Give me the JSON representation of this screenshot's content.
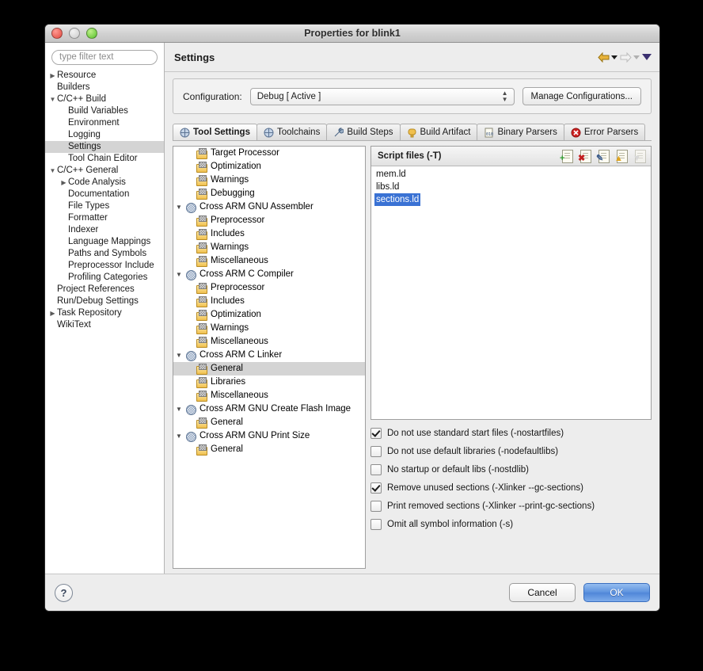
{
  "window": {
    "title": "Properties for blink1",
    "traffic_lights": [
      "close",
      "minimize",
      "zoom"
    ]
  },
  "sidebar": {
    "filter_placeholder": "type filter text",
    "items": [
      {
        "label": "Resource",
        "indent": 0,
        "twisty": "collapsed",
        "selected": false
      },
      {
        "label": "Builders",
        "indent": 0,
        "twisty": "none",
        "selected": false
      },
      {
        "label": "C/C++ Build",
        "indent": 0,
        "twisty": "expanded",
        "selected": false
      },
      {
        "label": "Build Variables",
        "indent": 1,
        "twisty": "none",
        "selected": false
      },
      {
        "label": "Environment",
        "indent": 1,
        "twisty": "none",
        "selected": false
      },
      {
        "label": "Logging",
        "indent": 1,
        "twisty": "none",
        "selected": false
      },
      {
        "label": "Settings",
        "indent": 1,
        "twisty": "none",
        "selected": true
      },
      {
        "label": "Tool Chain Editor",
        "indent": 1,
        "twisty": "none",
        "selected": false
      },
      {
        "label": "C/C++ General",
        "indent": 0,
        "twisty": "expanded",
        "selected": false
      },
      {
        "label": "Code Analysis",
        "indent": 1,
        "twisty": "collapsed",
        "selected": false
      },
      {
        "label": "Documentation",
        "indent": 1,
        "twisty": "none",
        "selected": false
      },
      {
        "label": "File Types",
        "indent": 1,
        "twisty": "none",
        "selected": false
      },
      {
        "label": "Formatter",
        "indent": 1,
        "twisty": "none",
        "selected": false
      },
      {
        "label": "Indexer",
        "indent": 1,
        "twisty": "none",
        "selected": false
      },
      {
        "label": "Language Mappings",
        "indent": 1,
        "twisty": "none",
        "selected": false
      },
      {
        "label": "Paths and Symbols",
        "indent": 1,
        "twisty": "none",
        "selected": false
      },
      {
        "label": "Preprocessor Include",
        "indent": 1,
        "twisty": "none",
        "selected": false
      },
      {
        "label": "Profiling Categories",
        "indent": 1,
        "twisty": "none",
        "selected": false
      },
      {
        "label": "Project References",
        "indent": 0,
        "twisty": "none",
        "selected": false
      },
      {
        "label": "Run/Debug Settings",
        "indent": 0,
        "twisty": "none",
        "selected": false
      },
      {
        "label": "Task Repository",
        "indent": 0,
        "twisty": "collapsed",
        "selected": false
      },
      {
        "label": "WikiText",
        "indent": 0,
        "twisty": "none",
        "selected": false
      }
    ]
  },
  "page": {
    "title": "Settings",
    "nav": {
      "back_icon": "back-arrow-icon",
      "back_menu_icon": "chevron-down-icon",
      "forward_icon": "forward-arrow-icon",
      "forward_menu_icon": "chevron-down-icon",
      "view_menu_icon": "chevron-down-icon"
    }
  },
  "configuration": {
    "label": "Configuration:",
    "value": "Debug  [ Active ]",
    "manage_button": "Manage Configurations..."
  },
  "tabs": [
    {
      "label": "Tool Settings",
      "icon": "tool-icon",
      "active": true
    },
    {
      "label": "Toolchains",
      "icon": "tool-icon",
      "active": false
    },
    {
      "label": "Build Steps",
      "icon": "wrench-icon",
      "active": false
    },
    {
      "label": "Build Artifact",
      "icon": "artifact-icon",
      "active": false
    },
    {
      "label": "Binary Parsers",
      "icon": "binary-icon",
      "active": false
    },
    {
      "label": "Error Parsers",
      "icon": "error-icon",
      "active": false
    }
  ],
  "tool_tree": [
    {
      "label": "Target Processor",
      "indent": 1,
      "twisty": "none",
      "icon": "folder",
      "selected": false
    },
    {
      "label": "Optimization",
      "indent": 1,
      "twisty": "none",
      "icon": "folder",
      "selected": false
    },
    {
      "label": "Warnings",
      "indent": 1,
      "twisty": "none",
      "icon": "folder",
      "selected": false
    },
    {
      "label": "Debugging",
      "indent": 1,
      "twisty": "none",
      "icon": "folder",
      "selected": false
    },
    {
      "label": "Cross ARM GNU Assembler",
      "indent": 0,
      "twisty": "expanded",
      "icon": "tool",
      "selected": false
    },
    {
      "label": "Preprocessor",
      "indent": 1,
      "twisty": "none",
      "icon": "folder",
      "selected": false
    },
    {
      "label": "Includes",
      "indent": 1,
      "twisty": "none",
      "icon": "folder",
      "selected": false
    },
    {
      "label": "Warnings",
      "indent": 1,
      "twisty": "none",
      "icon": "folder",
      "selected": false
    },
    {
      "label": "Miscellaneous",
      "indent": 1,
      "twisty": "none",
      "icon": "folder",
      "selected": false
    },
    {
      "label": "Cross ARM C Compiler",
      "indent": 0,
      "twisty": "expanded",
      "icon": "tool",
      "selected": false
    },
    {
      "label": "Preprocessor",
      "indent": 1,
      "twisty": "none",
      "icon": "folder",
      "selected": false
    },
    {
      "label": "Includes",
      "indent": 1,
      "twisty": "none",
      "icon": "folder",
      "selected": false
    },
    {
      "label": "Optimization",
      "indent": 1,
      "twisty": "none",
      "icon": "folder",
      "selected": false
    },
    {
      "label": "Warnings",
      "indent": 1,
      "twisty": "none",
      "icon": "folder",
      "selected": false
    },
    {
      "label": "Miscellaneous",
      "indent": 1,
      "twisty": "none",
      "icon": "folder",
      "selected": false
    },
    {
      "label": "Cross ARM C Linker",
      "indent": 0,
      "twisty": "expanded",
      "icon": "tool",
      "selected": false
    },
    {
      "label": "General",
      "indent": 1,
      "twisty": "none",
      "icon": "folder",
      "selected": true
    },
    {
      "label": "Libraries",
      "indent": 1,
      "twisty": "none",
      "icon": "folder",
      "selected": false
    },
    {
      "label": "Miscellaneous",
      "indent": 1,
      "twisty": "none",
      "icon": "folder",
      "selected": false
    },
    {
      "label": "Cross ARM GNU Create Flash Image",
      "indent": 0,
      "twisty": "expanded",
      "icon": "tool",
      "selected": false
    },
    {
      "label": "General",
      "indent": 1,
      "twisty": "none",
      "icon": "folder",
      "selected": false
    },
    {
      "label": "Cross ARM GNU Print Size",
      "indent": 0,
      "twisty": "expanded",
      "icon": "tool",
      "selected": false
    },
    {
      "label": "General",
      "indent": 1,
      "twisty": "none",
      "icon": "folder",
      "selected": false
    }
  ],
  "script_files": {
    "title": "Script files (-T)",
    "toolbar": [
      {
        "name": "add-file-icon",
        "glyph": "+",
        "color": "#2c9c2c",
        "enabled": true
      },
      {
        "name": "delete-file-icon",
        "glyph": "✖",
        "color": "#c31f1f",
        "enabled": true
      },
      {
        "name": "edit-file-icon",
        "glyph": "✎",
        "color": "#3b5c8c",
        "enabled": true
      },
      {
        "name": "move-up-icon",
        "glyph": "▲",
        "color": "#e0a41e",
        "enabled": true
      },
      {
        "name": "move-down-icon",
        "glyph": "▼",
        "color": "#c3c3c3",
        "enabled": false
      }
    ],
    "items": [
      {
        "label": "mem.ld",
        "selected": false
      },
      {
        "label": "libs.ld",
        "selected": false
      },
      {
        "label": "sections.ld",
        "selected": true
      }
    ]
  },
  "options": [
    {
      "label": "Do not use standard start files (-nostartfiles)",
      "checked": true
    },
    {
      "label": "Do not use default libraries (-nodefaultlibs)",
      "checked": false
    },
    {
      "label": "No startup or default libs (-nostdlib)",
      "checked": false
    },
    {
      "label": "Remove unused sections (-Xlinker --gc-sections)",
      "checked": true
    },
    {
      "label": "Print removed sections (-Xlinker --print-gc-sections)",
      "checked": false
    },
    {
      "label": "Omit all symbol information (-s)",
      "checked": false
    }
  ],
  "footer": {
    "help_icon": "help-question-icon",
    "cancel": "Cancel",
    "ok": "OK"
  },
  "colors": {
    "selection_blue": "#3a72d4",
    "default_button_blue": "#5e93de",
    "tree_selection_gray": "#d4d4d4"
  }
}
